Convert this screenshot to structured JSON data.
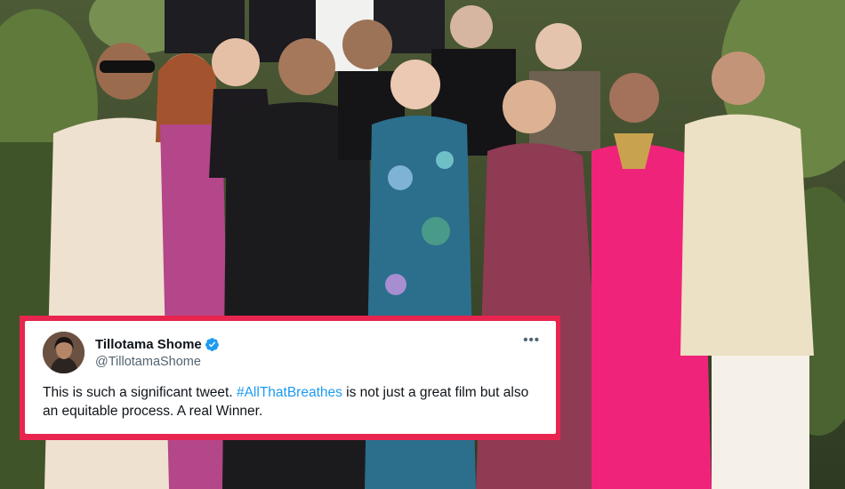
{
  "photo": {
    "description_icon": "group-photo"
  },
  "tweet": {
    "author": {
      "display_name": "Tillotama Shome",
      "handle": "@TillotamaShome",
      "verified_icon": "verified-badge-icon",
      "avatar_icon": "profile-avatar"
    },
    "more_label": "•••",
    "text_before": "This is such a significant tweet. ",
    "hashtag": "#AllThatBreathes",
    "text_after": " is not just a great film but also  an equitable process. A real Winner."
  },
  "colors": {
    "accent_frame": "#e8254f",
    "hashtag": "#1d9bf0",
    "verified": "#1d9bf0",
    "text": "#0f1419",
    "secondary_text": "#536471"
  }
}
